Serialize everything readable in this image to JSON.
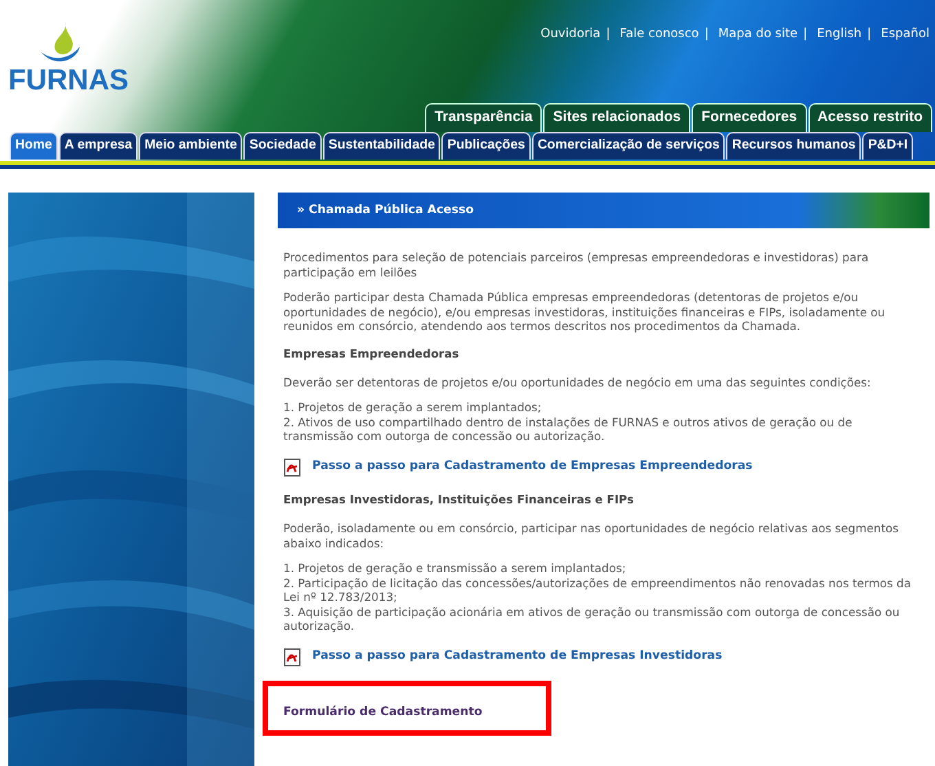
{
  "logo": {
    "text": "FURNAS"
  },
  "top_links": [
    {
      "label": "Ouvidoria",
      "separator": "|"
    },
    {
      "label": "Fale conosco",
      "separator": "|"
    },
    {
      "label": "Mapa do site",
      "separator": "|"
    },
    {
      "label": "English",
      "separator": "|"
    },
    {
      "label": "Español"
    }
  ],
  "upper_tabs": [
    {
      "label": "Transparência"
    },
    {
      "label": "Sites relacionados"
    },
    {
      "label": "Fornecedores"
    },
    {
      "label": "Acesso restrito"
    }
  ],
  "main_nav": [
    {
      "label": "Home",
      "selected": true
    },
    {
      "label": "A empresa",
      "selected": false
    },
    {
      "label": "Meio ambiente",
      "selected": false
    },
    {
      "label": "Sociedade",
      "selected": false
    },
    {
      "label": "Sustentabilidade",
      "selected": false
    },
    {
      "label": "Publicações",
      "selected": false
    },
    {
      "label": "Comercialização de serviços",
      "selected": false
    },
    {
      "label": "Recursos humanos",
      "selected": false
    },
    {
      "label": "P&D+I",
      "selected": false
    }
  ],
  "content": {
    "title": "» Chamada Pública Acesso",
    "blocks": [
      {
        "kind": "paragraph",
        "text": "Procedimentos para seleção de potenciais parceiros (empresas empreendedoras e investidoras) para participação em leilões"
      },
      {
        "kind": "paragraph",
        "text": "Poderão participar desta Chamada Pública empresas empreendedoras (detentoras de projetos e/ou oportunidades de negócio), e/ou empresas investidoras, instituições financeiras e FIPs, isoladamente ou reunidos em consórcio, atendendo aos termos descritos nos procedimentos da Chamada."
      },
      {
        "kind": "heading",
        "text": "Empresas Empreendedoras"
      },
      {
        "kind": "paragraph",
        "text": "Deverão ser detentoras de projetos e/ou oportunidades de negócio em uma das seguintes condições:"
      },
      {
        "kind": "list",
        "items": [
          "1. Projetos de geração a serem implantados;",
          "2. Ativos de uso compartilhado dentro de instalações de FURNAS e outros ativos de geração ou de transmissão com outorga de concessão ou autorização."
        ]
      },
      {
        "kind": "pdf_link",
        "text": "Passo a passo para Cadastramento de Empresas Empreendedoras"
      },
      {
        "kind": "heading",
        "text": "Empresas Investidoras, Instituições Financeiras e FIPs"
      },
      {
        "kind": "paragraph",
        "text": "Poderão, isoladamente ou em consórcio, participar nas oportunidades de negócio relativas aos segmentos abaixo indicados:"
      },
      {
        "kind": "list",
        "items": [
          "1. Projetos de geração e transmissão a serem implantados;",
          "2. Participação de licitação das concessões/autorizações de empreendimentos não renovadas nos termos da Lei nº 12.783/2013;",
          "3. Aquisição de participação acionária em ativos de geração ou transmissão com outorga de concessão ou autorização."
        ]
      },
      {
        "kind": "pdf_link",
        "text": "Passo a passo para Cadastramento de Empresas Investidoras"
      },
      {
        "kind": "link",
        "text": "Formulário de Cadastramento",
        "highlighted": true
      }
    ]
  }
}
